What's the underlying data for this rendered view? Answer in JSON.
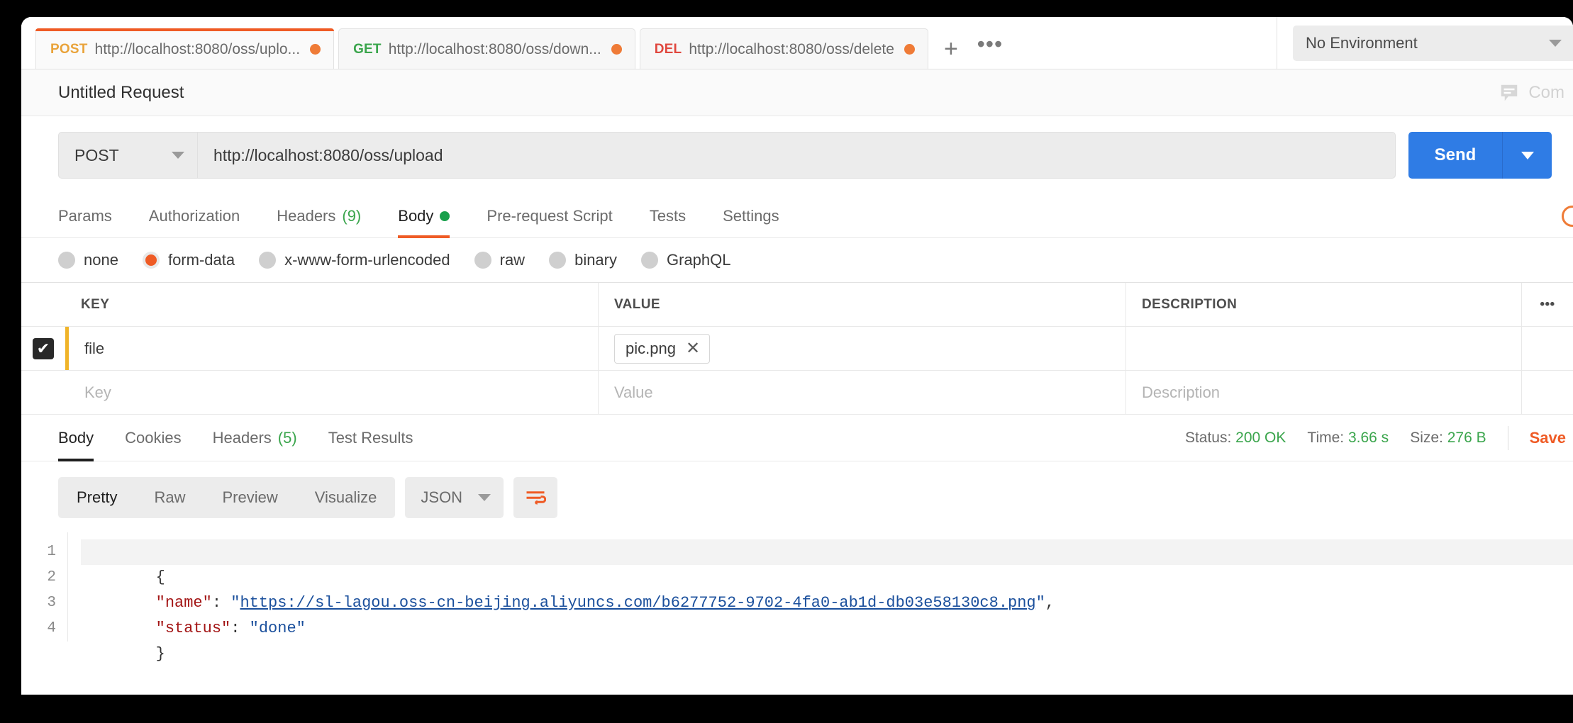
{
  "tabs": [
    {
      "method": "POST",
      "method_class": "m-post",
      "url": "http://localhost:8080/oss/uplo...",
      "active": true
    },
    {
      "method": "GET",
      "method_class": "m-get",
      "url": "http://localhost:8080/oss/down...",
      "active": false
    },
    {
      "method": "DEL",
      "method_class": "m-del",
      "url": "http://localhost:8080/oss/delete",
      "active": false
    }
  ],
  "tabstrip": {
    "new_tab_label": "+",
    "more_label": "•••"
  },
  "environment": {
    "selected": "No Environment"
  },
  "header": {
    "request_title": "Untitled Request",
    "comments_label": "Com"
  },
  "urlbar": {
    "method": "POST",
    "url": "http://localhost:8080/oss/upload",
    "send_label": "Send"
  },
  "request_tabs": [
    {
      "label": "Params",
      "count": "",
      "dot": false,
      "active": false
    },
    {
      "label": "Authorization",
      "count": "",
      "dot": false,
      "active": false
    },
    {
      "label": "Headers",
      "count": "(9)",
      "dot": false,
      "active": false
    },
    {
      "label": "Body",
      "count": "",
      "dot": true,
      "active": true
    },
    {
      "label": "Pre-request Script",
      "count": "",
      "dot": false,
      "active": false
    },
    {
      "label": "Tests",
      "count": "",
      "dot": false,
      "active": false
    },
    {
      "label": "Settings",
      "count": "",
      "dot": false,
      "active": false
    }
  ],
  "body_types": [
    {
      "label": "none",
      "selected": false
    },
    {
      "label": "form-data",
      "selected": true
    },
    {
      "label": "x-www-form-urlencoded",
      "selected": false
    },
    {
      "label": "raw",
      "selected": false
    },
    {
      "label": "binary",
      "selected": false
    },
    {
      "label": "GraphQL",
      "selected": false
    }
  ],
  "kv_table": {
    "headers": {
      "key": "KEY",
      "value": "VALUE",
      "description": "DESCRIPTION",
      "options": "•••"
    },
    "rows": [
      {
        "checked": true,
        "check_glyph": "✔",
        "key": "file",
        "value": "pic.png",
        "value_is_file": true,
        "file_remove": "✕",
        "description": ""
      }
    ],
    "placeholders": {
      "key": "Key",
      "value": "Value",
      "description": "Description"
    }
  },
  "response_tabs": [
    {
      "label": "Body",
      "count": "",
      "active": true
    },
    {
      "label": "Cookies",
      "count": "",
      "active": false
    },
    {
      "label": "Headers",
      "count": "(5)",
      "active": false
    },
    {
      "label": "Test Results",
      "count": "",
      "active": false
    }
  ],
  "response_meta": {
    "status_label": "Status:",
    "status_value": "200 OK",
    "time_label": "Time:",
    "time_value": "3.66 s",
    "size_label": "Size:",
    "size_value": "276 B",
    "save_label": "Save"
  },
  "response_toolbar": {
    "views": [
      {
        "label": "Pretty",
        "active": true
      },
      {
        "label": "Raw",
        "active": false
      },
      {
        "label": "Preview",
        "active": false
      },
      {
        "label": "Visualize",
        "active": false
      }
    ],
    "format": "JSON",
    "wrap_icon": "wrap-text-icon"
  },
  "response_body": {
    "line_numbers": [
      "1",
      "2",
      "3",
      "4"
    ],
    "lines": [
      {
        "type": "brace",
        "text": "{"
      },
      {
        "type": "pair_link",
        "key": "\"name\"",
        "colon": ": ",
        "quote_open": "\"",
        "link": "https://sl-lagou.oss-cn-beijing.aliyuncs.com/b6277752-9702-4fa0-ab1d-db03e58130c8.png",
        "quote_close": "\"",
        "tail": ","
      },
      {
        "type": "pair",
        "key": "\"status\"",
        "colon": ": ",
        "value": "\"done\""
      },
      {
        "type": "brace",
        "text": "}"
      }
    ]
  },
  "colors": {
    "accent_orange": "#ef5b25",
    "send_blue": "#2f7ce5",
    "green": "#3aa54c",
    "method_post": "#e9a33a",
    "method_get": "#3aa54c",
    "method_del": "#e0473e"
  }
}
